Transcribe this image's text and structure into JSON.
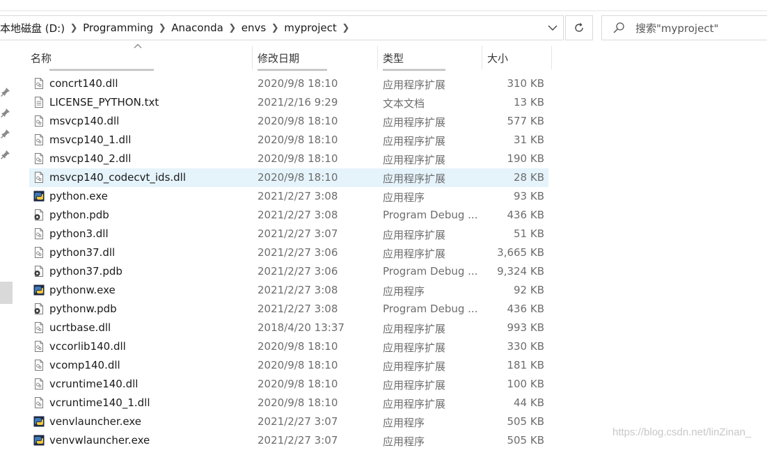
{
  "breadcrumb": [
    "本地磁盘 (D:)",
    "Programming",
    "Anaconda",
    "envs",
    "myproject"
  ],
  "search": {
    "placeholder": "搜索\"myproject\""
  },
  "columns": {
    "name": "名称",
    "date": "修改日期",
    "type": "类型",
    "size": "大小"
  },
  "files": [
    {
      "name": "concrt140.dll",
      "date": "2020/9/8 18:10",
      "type": "应用程序扩展",
      "size": "310 KB",
      "icon": "dll-file-icon"
    },
    {
      "name": "LICENSE_PYTHON.txt",
      "date": "2021/2/16 9:29",
      "type": "文本文档",
      "size": "13 KB",
      "icon": "text-file-icon"
    },
    {
      "name": "msvcp140.dll",
      "date": "2020/9/8 18:10",
      "type": "应用程序扩展",
      "size": "577 KB",
      "icon": "dll-file-icon"
    },
    {
      "name": "msvcp140_1.dll",
      "date": "2020/9/8 18:10",
      "type": "应用程序扩展",
      "size": "31 KB",
      "icon": "dll-file-icon"
    },
    {
      "name": "msvcp140_2.dll",
      "date": "2020/9/8 18:10",
      "type": "应用程序扩展",
      "size": "190 KB",
      "icon": "dll-file-icon"
    },
    {
      "name": "msvcp140_codecvt_ids.dll",
      "date": "2020/9/8 18:10",
      "type": "应用程序扩展",
      "size": "28 KB",
      "icon": "dll-file-icon",
      "selected": true
    },
    {
      "name": "python.exe",
      "date": "2021/2/27 3:08",
      "type": "应用程序",
      "size": "93 KB",
      "icon": "python-exe-icon"
    },
    {
      "name": "python.pdb",
      "date": "2021/2/27 3:08",
      "type": "Program Debug ...",
      "size": "436 KB",
      "icon": "pdb-file-icon"
    },
    {
      "name": "python3.dll",
      "date": "2021/2/27 3:07",
      "type": "应用程序扩展",
      "size": "51 KB",
      "icon": "dll-file-icon"
    },
    {
      "name": "python37.dll",
      "date": "2021/2/27 3:06",
      "type": "应用程序扩展",
      "size": "3,665 KB",
      "icon": "dll-file-icon"
    },
    {
      "name": "python37.pdb",
      "date": "2021/2/27 3:06",
      "type": "Program Debug ...",
      "size": "9,324 KB",
      "icon": "pdb-file-icon"
    },
    {
      "name": "pythonw.exe",
      "date": "2021/2/27 3:08",
      "type": "应用程序",
      "size": "92 KB",
      "icon": "python-exe-icon"
    },
    {
      "name": "pythonw.pdb",
      "date": "2021/2/27 3:08",
      "type": "Program Debug ...",
      "size": "436 KB",
      "icon": "pdb-file-icon"
    },
    {
      "name": "ucrtbase.dll",
      "date": "2018/4/20 13:37",
      "type": "应用程序扩展",
      "size": "993 KB",
      "icon": "dll-file-icon"
    },
    {
      "name": "vccorlib140.dll",
      "date": "2020/9/8 18:10",
      "type": "应用程序扩展",
      "size": "330 KB",
      "icon": "dll-file-icon"
    },
    {
      "name": "vcomp140.dll",
      "date": "2020/9/8 18:10",
      "type": "应用程序扩展",
      "size": "181 KB",
      "icon": "dll-file-icon"
    },
    {
      "name": "vcruntime140.dll",
      "date": "2020/9/8 18:10",
      "type": "应用程序扩展",
      "size": "100 KB",
      "icon": "dll-file-icon"
    },
    {
      "name": "vcruntime140_1.dll",
      "date": "2020/9/8 18:10",
      "type": "应用程序扩展",
      "size": "44 KB",
      "icon": "dll-file-icon"
    },
    {
      "name": "venvlauncher.exe",
      "date": "2021/2/27 3:07",
      "type": "应用程序",
      "size": "505 KB",
      "icon": "python-exe-icon"
    },
    {
      "name": "venvwlauncher.exe",
      "date": "2021/2/27 3:07",
      "type": "应用程序",
      "size": "505 KB",
      "icon": "python-exe-icon"
    }
  ],
  "watermark": "https://blog.csdn.net/linZinan_"
}
